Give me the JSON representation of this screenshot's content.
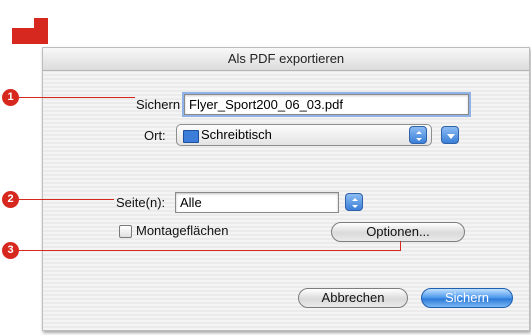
{
  "dialog": {
    "title": "Als PDF exportieren",
    "save_as_label": "Sichern",
    "save_as_value": "Flyer_Sport200_06_03.pdf",
    "location_label": "Ort:",
    "location_value": "Schreibtisch",
    "pages_label": "Seite(n):",
    "pages_value": "Alle",
    "pasteboard_label": "Montageflächen",
    "pasteboard_checked": false,
    "options_button": "Optionen...",
    "cancel_button": "Abbrechen",
    "save_button": "Sichern"
  },
  "callouts": [
    {
      "number": "1"
    },
    {
      "number": "2"
    },
    {
      "number": "3"
    }
  ],
  "colors": {
    "callout": "#d7281f",
    "accent": "#3a7fd8"
  }
}
